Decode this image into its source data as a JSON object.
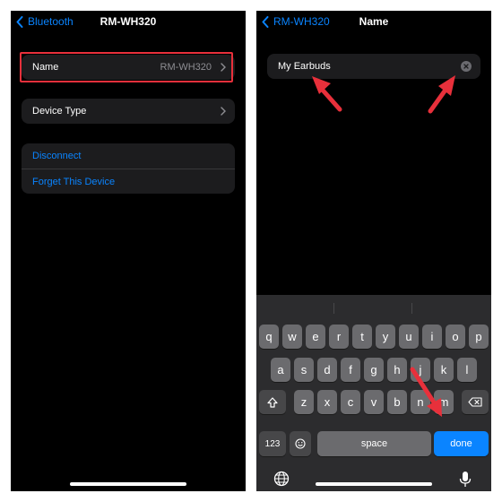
{
  "left": {
    "back_label": "Bluetooth",
    "title": "RM-WH320",
    "name_row": {
      "label": "Name",
      "value": "RM-WH320"
    },
    "device_type_row": {
      "label": "Device Type"
    },
    "actions": [
      "Disconnect",
      "Forget This Device"
    ]
  },
  "right": {
    "back_label": "RM-WH320",
    "title": "Name",
    "field_value": "My Earbuds",
    "keyboard": {
      "row1": [
        "q",
        "w",
        "e",
        "r",
        "t",
        "y",
        "u",
        "i",
        "o",
        "p"
      ],
      "row2": [
        "a",
        "s",
        "d",
        "f",
        "g",
        "h",
        "j",
        "k",
        "l"
      ],
      "row3": [
        "z",
        "x",
        "c",
        "v",
        "b",
        "n",
        "m"
      ],
      "numbers_key": "123",
      "space_key": "space",
      "done_key": "done"
    }
  },
  "colors": {
    "accent": "#0a84ff",
    "annotation": "#e8303b",
    "background": "#000000",
    "cell": "#1c1c1e"
  }
}
